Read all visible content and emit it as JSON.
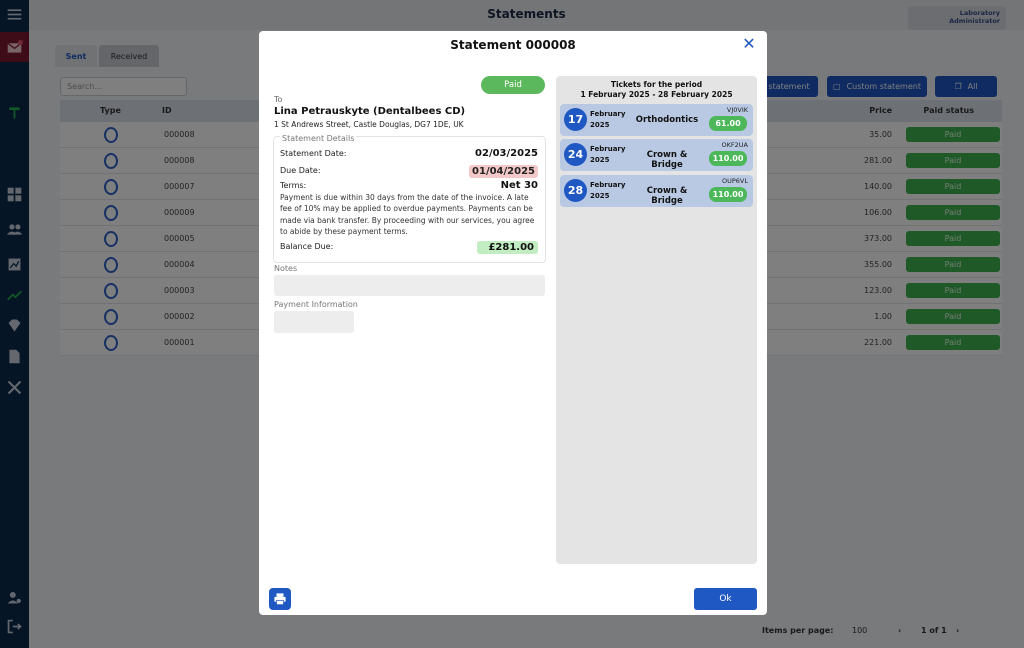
{
  "header": {
    "title": "Statements",
    "user_line1": "Laboratory",
    "user_line2": "Administrator"
  },
  "tabs": [
    {
      "label": "Sent"
    },
    {
      "label": "Received"
    }
  ],
  "search": {
    "placeholder": "Search..."
  },
  "toolbar": {
    "statement_label": "statement",
    "custom_label": "Custom statement",
    "all_label": "All"
  },
  "table": {
    "headers": {
      "type": "Type",
      "id": "ID",
      "price": "Price",
      "paid_status": "Paid status"
    },
    "rows": [
      {
        "id": "000008",
        "price": "35.00",
        "status": "Paid"
      },
      {
        "id": "000008",
        "price": "281.00",
        "status": "Paid"
      },
      {
        "id": "000007",
        "price": "140.00",
        "status": "Paid"
      },
      {
        "id": "000009",
        "price": "106.00",
        "status": "Paid"
      },
      {
        "id": "000005",
        "price": "373.00",
        "status": "Paid"
      },
      {
        "id": "000004",
        "price": "355.00",
        "status": "Paid"
      },
      {
        "id": "000003",
        "price": "123.00",
        "status": "Paid"
      },
      {
        "id": "000002",
        "price": "1.00",
        "status": "Paid"
      },
      {
        "id": "000001",
        "price": "221.00",
        "status": "Paid"
      }
    ]
  },
  "pager": {
    "items_label": "Items per page:",
    "per_page": "100",
    "range": "1 of 1"
  },
  "modal": {
    "title": "Statement 000008",
    "status": "Paid",
    "to_label": "To",
    "to_name": "Lina Petrauskyte (Dentalbees CD)",
    "to_address": "1 St Andrews Street, Castle Douglas, DG7 1DE, UK",
    "details_label": "Statement Details",
    "statement_date_label": "Statement Date:",
    "statement_date": "02/03/2025",
    "due_date_label": "Due Date:",
    "due_date": "01/04/2025",
    "terms_label": "Terms:",
    "terms": "Net 30",
    "terms_text": "Payment is due within 30 days from the date of the invoice. A late fee of 10% may be applied to overdue payments. Payments can be made via bank transfer. By proceeding with our services, you agree to abide by these payment terms.",
    "balance_label": "Balance Due:",
    "balance": "£281.00",
    "notes_label": "Notes",
    "payment_info_label": "Payment Information",
    "tickets_title": "Tickets for the period",
    "tickets_period": "1 February 2025 - 28 February 2025",
    "tickets": [
      {
        "day": "17",
        "month": "February",
        "year": "2025",
        "type": "Orthodontics",
        "code": "VJ0VIK",
        "price": "61.00"
      },
      {
        "day": "24",
        "month": "February",
        "year": "2025",
        "type": "Crown & Bridge",
        "code": "OKF2UA",
        "price": "110.00"
      },
      {
        "day": "28",
        "month": "February",
        "year": "2025",
        "type": "Crown & Bridge",
        "code": "OUP6VL",
        "price": "110.00"
      }
    ],
    "ok_label": "Ok"
  },
  "colors": {
    "accent": "#1f57c3",
    "paid": "#5cb85c",
    "sidebar": "#0b2a4c"
  }
}
